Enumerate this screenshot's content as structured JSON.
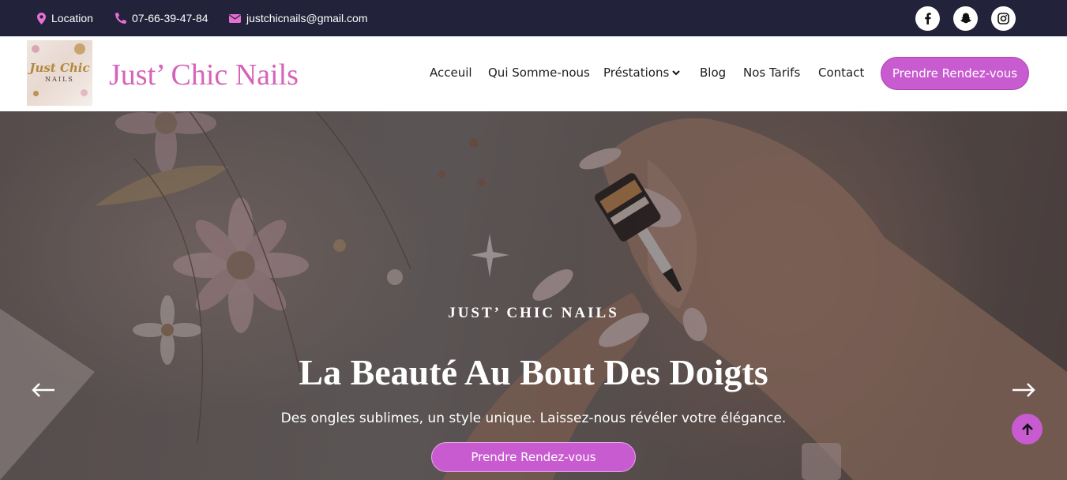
{
  "topbar": {
    "location_label": "Location",
    "phone": "07-66-39-47-84",
    "email": "justchicnails@gmail.com",
    "social": [
      {
        "icon": "facebook-icon"
      },
      {
        "icon": "snapchat-icon"
      },
      {
        "icon": "instagram-icon"
      }
    ]
  },
  "header": {
    "logo": {
      "line1": "Just Chic",
      "line2": "NAILS"
    },
    "brand": "Just’ Chic Nails",
    "nav": {
      "home": "Acceuil",
      "about": "Qui Somme-nous",
      "services": "Préstations",
      "blog": "Blog",
      "tarifs": "Nos Tarifs",
      "contact": "Contact"
    },
    "cta": "Prendre Rendez-vous"
  },
  "hero": {
    "eyebrow": "JUST’ CHIC NAILS",
    "title": "La Beauté Au Bout Des Doigts",
    "subtitle": "Des ongles sublimes, un style unique. Laissez-nous révéler votre élégance.",
    "cta": "Prendre Rendez-vous"
  },
  "colors": {
    "topbar_bg": "#22223a",
    "accent": "#c95bd0",
    "brand_pink": "#d763b9"
  }
}
